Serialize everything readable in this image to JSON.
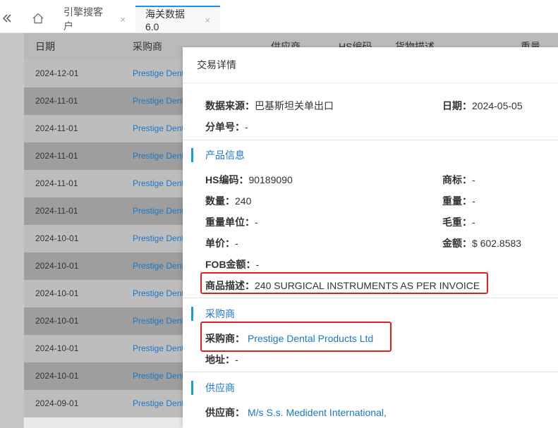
{
  "tabs": {
    "home_icon": "home-icon",
    "collapse_icon": "double-chevron-left-icon",
    "items": [
      {
        "label": "引擎搜客户",
        "close": "×"
      },
      {
        "label": "海关数据6.0",
        "close": "×"
      }
    ]
  },
  "table": {
    "headers": {
      "date": "日期",
      "buyer": "采购商",
      "supplier": "供应商",
      "hs": "HS编码",
      "desc": "货物描述",
      "weight": "重量"
    },
    "rows": [
      {
        "date": "2024-12-01",
        "buyer": "Prestige Dent"
      },
      {
        "date": "2024-11-01",
        "buyer": "Prestige Dent"
      },
      {
        "date": "2024-11-01",
        "buyer": "Prestige Dent"
      },
      {
        "date": "2024-11-01",
        "buyer": "Prestige Dent"
      },
      {
        "date": "2024-11-01",
        "buyer": "Prestige Dent"
      },
      {
        "date": "2024-11-01",
        "buyer": "Prestige Dent"
      },
      {
        "date": "2024-10-01",
        "buyer": "Prestige Dent"
      },
      {
        "date": "2024-10-01",
        "buyer": "Prestige Dent"
      },
      {
        "date": "2024-10-01",
        "buyer": "Prestige Dent"
      },
      {
        "date": "2024-10-01",
        "buyer": "Prestige Dent"
      },
      {
        "date": "2024-10-01",
        "buyer": "Prestige Dent"
      },
      {
        "date": "2024-10-01",
        "buyer": "Prestige Dent"
      },
      {
        "date": "2024-09-01",
        "buyer": "Prestige Dent"
      }
    ]
  },
  "detail": {
    "title": "交易详情",
    "source_label": "数据来源：",
    "source_value": "巴基斯坦关单出口",
    "date_label": "日期：",
    "date_value": "2024-05-05",
    "bill_label": "分单号：",
    "bill_value": "-",
    "product": {
      "section_title": "产品信息",
      "hs_label": "HS编码：",
      "hs_value": "90189090",
      "brand_label": "商标：",
      "brand_value": "-",
      "qty_label": "数量：",
      "qty_value": "240",
      "weight_label": "重量：",
      "weight_value": "-",
      "weight_unit_label": "重量单位：",
      "weight_unit_value": "-",
      "gross_label": "毛重：",
      "gross_value": "-",
      "price_label": "单价：",
      "price_value": "-",
      "amount_label": "金额：",
      "amount_value": "$ 602.8583",
      "fob_label": "FOB金额：",
      "fob_value": "-",
      "desc_label": "商品描述：",
      "desc_value": "240 SURGICAL INSTRUMENTS AS PER INVOICE"
    },
    "buyer": {
      "section_title": "采购商",
      "name_label": "采购商：",
      "name_value": "Prestige Dental Products Ltd",
      "addr_label": "地址：",
      "addr_value": "-"
    },
    "supplier": {
      "section_title": "供应商",
      "name_label": "供应商：",
      "name_value": "M/s S.s. Medident International,"
    }
  },
  "colors": {
    "accent": "#1b77c7",
    "section_bar": "#1b9bd7",
    "highlight_box": "#e02222",
    "active_tab_border": "#1890ff"
  }
}
